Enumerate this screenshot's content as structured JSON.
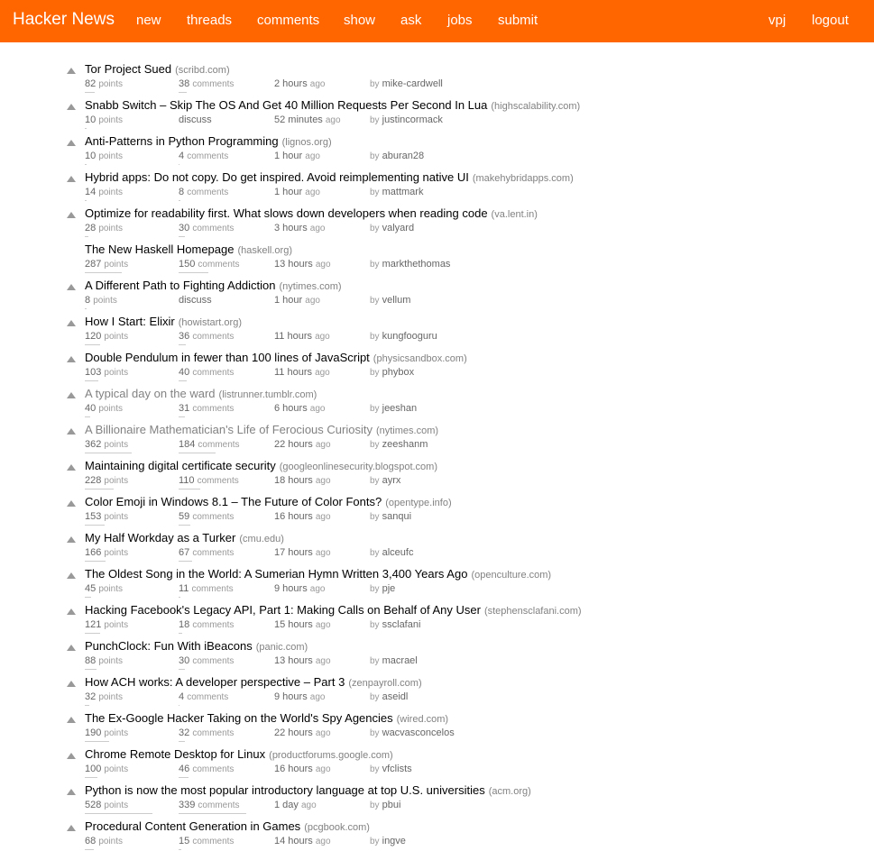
{
  "header": {
    "brand": "Hacker News",
    "nav": [
      "new",
      "threads",
      "comments",
      "show",
      "ask",
      "jobs",
      "submit"
    ],
    "user": "vpj",
    "logout": "logout"
  },
  "labels": {
    "points": "points",
    "comments": "comments",
    "ago": "ago",
    "by": "by"
  },
  "stories": [
    {
      "title": "Tor Project Sued",
      "site": "(scribd.com)",
      "points": "82",
      "comments": "38",
      "time": "2 hours",
      "author": "mike-cardwell",
      "vote": true,
      "visited": false,
      "points_fill": 0.15,
      "comments_fill": 0.12
    },
    {
      "title": "Snabb Switch – Skip The OS And Get 40 Million Requests Per Second In Lua",
      "site": "(highscalability.com)",
      "points": "10",
      "comments": "discuss",
      "time": "52 minutes",
      "author": "justincormack",
      "vote": true,
      "visited": false,
      "points_fill": 0.02,
      "comments_fill": 0
    },
    {
      "title": "Anti-Patterns in Python Programming",
      "site": "(lignos.org)",
      "points": "10",
      "comments": "4",
      "time": "1 hour",
      "author": "aburan28",
      "vote": true,
      "visited": false,
      "points_fill": 0.02,
      "comments_fill": 0.01
    },
    {
      "title": "Hybrid apps: Do not copy. Do get inspired. Avoid reimplementing native UI",
      "site": "(makehybridapps.com)",
      "points": "14",
      "comments": "8",
      "time": "1 hour",
      "author": "mattmark",
      "vote": true,
      "visited": false,
      "points_fill": 0.03,
      "comments_fill": 0.02
    },
    {
      "title": "Optimize for readability first. What slows down developers when reading code",
      "site": "(va.lent.in)",
      "points": "28",
      "comments": "30",
      "time": "3 hours",
      "author": "valyard",
      "vote": true,
      "visited": false,
      "points_fill": 0.05,
      "comments_fill": 0.09
    },
    {
      "title": "The New Haskell Homepage",
      "site": "(haskell.org)",
      "points": "287",
      "comments": "150",
      "time": "13 hours",
      "author": "markthethomas",
      "vote": false,
      "visited": false,
      "points_fill": 0.54,
      "comments_fill": 0.44
    },
    {
      "title": "A Different Path to Fighting Addiction",
      "site": "(nytimes.com)",
      "points": "8",
      "comments": "discuss",
      "time": "1 hour",
      "author": "vellum",
      "vote": true,
      "visited": false,
      "points_fill": 0.02,
      "comments_fill": 0
    },
    {
      "title": "How I Start: Elixir",
      "site": "(howistart.org)",
      "points": "120",
      "comments": "36",
      "time": "11 hours",
      "author": "kungfooguru",
      "vote": true,
      "visited": false,
      "points_fill": 0.23,
      "comments_fill": 0.11
    },
    {
      "title": "Double Pendulum in fewer than 100 lines of JavaScript",
      "site": "(physicsandbox.com)",
      "points": "103",
      "comments": "40",
      "time": "11 hours",
      "author": "phybox",
      "vote": true,
      "visited": false,
      "points_fill": 0.2,
      "comments_fill": 0.12
    },
    {
      "title": "A typical day on the ward",
      "site": "(listrunner.tumblr.com)",
      "points": "40",
      "comments": "31",
      "time": "6 hours",
      "author": "jeeshan",
      "vote": true,
      "visited": true,
      "points_fill": 0.08,
      "comments_fill": 0.09
    },
    {
      "title": "A Billionaire Mathematician's Life of Ferocious Curiosity",
      "site": "(nytimes.com)",
      "points": "362",
      "comments": "184",
      "time": "22 hours",
      "author": "zeeshanm",
      "vote": true,
      "visited": true,
      "points_fill": 0.69,
      "comments_fill": 0.54
    },
    {
      "title": "Maintaining digital certificate security",
      "site": "(googleonlinesecurity.blogspot.com)",
      "points": "228",
      "comments": "110",
      "time": "18 hours",
      "author": "ayrx",
      "vote": true,
      "visited": false,
      "points_fill": 0.43,
      "comments_fill": 0.32
    },
    {
      "title": "Color Emoji in Windows 8.1 – The Future of Color Fonts?",
      "site": "(opentype.info)",
      "points": "153",
      "comments": "59",
      "time": "16 hours",
      "author": "sanqui",
      "vote": true,
      "visited": false,
      "points_fill": 0.29,
      "comments_fill": 0.17
    },
    {
      "title": "My Half Workday as a Turker",
      "site": "(cmu.edu)",
      "points": "166",
      "comments": "67",
      "time": "17 hours",
      "author": "alceufc",
      "vote": true,
      "visited": false,
      "points_fill": 0.31,
      "comments_fill": 0.2
    },
    {
      "title": "The Oldest Song in the World: A Sumerian Hymn Written 3,400 Years Ago",
      "site": "(openculture.com)",
      "points": "45",
      "comments": "11",
      "time": "9 hours",
      "author": "pje",
      "vote": true,
      "visited": false,
      "points_fill": 0.09,
      "comments_fill": 0.03
    },
    {
      "title": "Hacking Facebook's Legacy API, Part 1: Making Calls on Behalf of Any User",
      "site": "(stephensclafani.com)",
      "points": "121",
      "comments": "18",
      "time": "15 hours",
      "author": "ssclafani",
      "vote": true,
      "visited": false,
      "points_fill": 0.23,
      "comments_fill": 0.05
    },
    {
      "title": "PunchClock: Fun With iBeacons",
      "site": "(panic.com)",
      "points": "88",
      "comments": "30",
      "time": "13 hours",
      "author": "macrael",
      "vote": true,
      "visited": false,
      "points_fill": 0.17,
      "comments_fill": 0.09
    },
    {
      "title": "How ACH works: A developer perspective – Part 3",
      "site": "(zenpayroll.com)",
      "points": "32",
      "comments": "4",
      "time": "9 hours",
      "author": "aseidl",
      "vote": true,
      "visited": false,
      "points_fill": 0.06,
      "comments_fill": 0.01
    },
    {
      "title": "The Ex-Google Hacker Taking on the World's Spy Agencies",
      "site": "(wired.com)",
      "points": "190",
      "comments": "32",
      "time": "22 hours",
      "author": "wacvasconcelos",
      "vote": true,
      "visited": false,
      "points_fill": 0.36,
      "comments_fill": 0.09
    },
    {
      "title": "Chrome Remote Desktop for Linux",
      "site": "(productforums.google.com)",
      "points": "100",
      "comments": "46",
      "time": "16 hours",
      "author": "vfclists",
      "vote": true,
      "visited": false,
      "points_fill": 0.19,
      "comments_fill": 0.14
    },
    {
      "title": "Python is now the most popular introductory language at top U.S. universities",
      "site": "(acm.org)",
      "points": "528",
      "comments": "339",
      "time": "1 day",
      "author": "pbui",
      "vote": true,
      "visited": false,
      "points_fill": 1.0,
      "comments_fill": 1.0
    },
    {
      "title": "Procedural Content Generation in Games",
      "site": "(pcgbook.com)",
      "points": "68",
      "comments": "15",
      "time": "14 hours",
      "author": "ingve",
      "vote": true,
      "visited": false,
      "points_fill": 0.13,
      "comments_fill": 0.04
    }
  ]
}
